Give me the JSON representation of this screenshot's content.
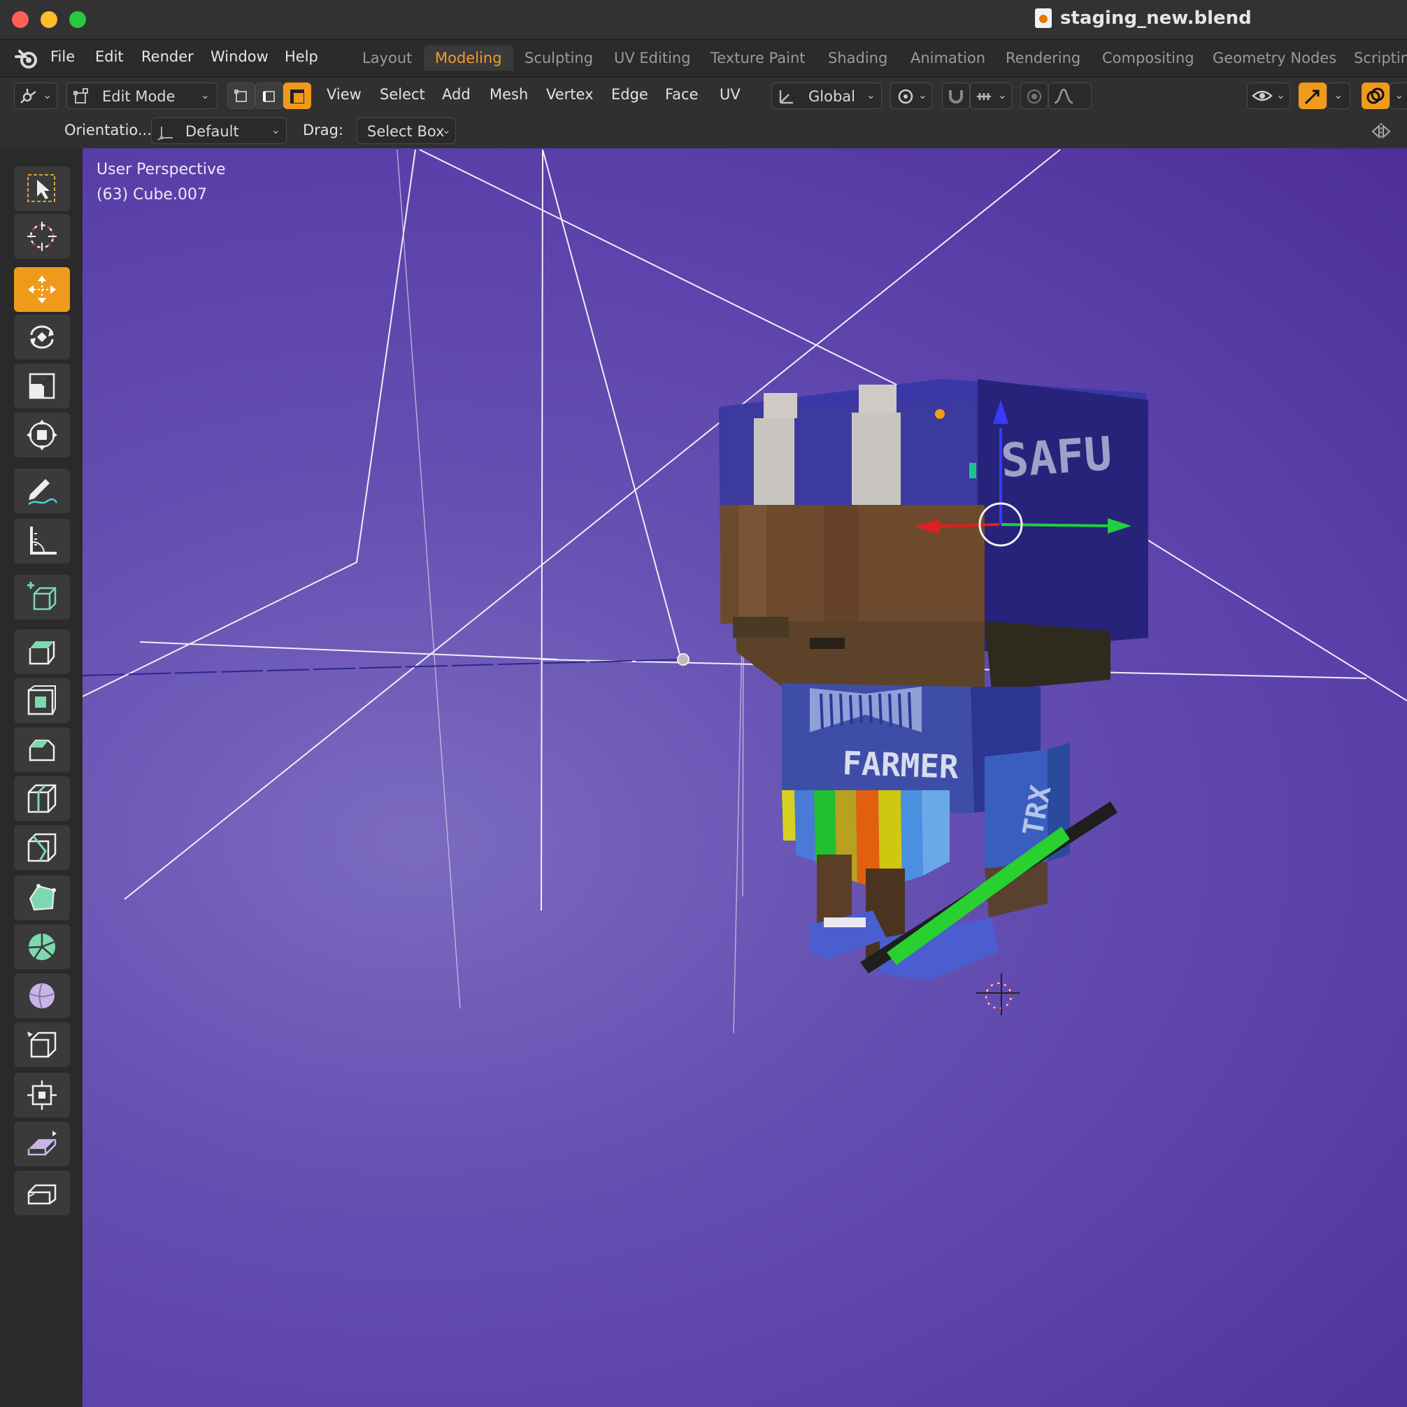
{
  "window": {
    "title": "staging_new.blend",
    "traffic_lights": {
      "close": "#ff5f57",
      "minimize": "#febc2e",
      "maximize": "#28c840"
    }
  },
  "menubar": {
    "items": [
      "File",
      "Edit",
      "Render",
      "Window",
      "Help"
    ],
    "workspaces": [
      "Layout",
      "Modeling",
      "Sculpting",
      "UV Editing",
      "Texture Paint",
      "Shading",
      "Animation",
      "Rendering",
      "Compositing",
      "Geometry Nodes",
      "Scriptin"
    ],
    "active_workspace": "Modeling"
  },
  "header": {
    "mode": "Edit Mode",
    "menus": [
      "View",
      "Select",
      "Add",
      "Mesh",
      "Vertex",
      "Edge",
      "Face",
      "UV"
    ],
    "transform_orientation": "Global",
    "accent": "#f09a1c"
  },
  "tool_settings": {
    "orientation_label": "Orientatio...",
    "orientation_value": "Default",
    "drag_label": "Drag:",
    "drag_value": "Select Box"
  },
  "viewport": {
    "view_name": "User Perspective",
    "object_info": "(63) Cube.007",
    "shirt_text": "FARMER",
    "hat_text": "SAFU",
    "arm_text": "TRX"
  },
  "toolbar": {
    "tools": [
      "select-box",
      "cursor",
      "move",
      "rotate",
      "scale",
      "transform",
      "annotate",
      "measure",
      "add-cube",
      "extrude",
      "inset",
      "bevel",
      "loop-cut",
      "knife",
      "poly-build",
      "spin",
      "smooth",
      "edge-slide",
      "shrink-fatten",
      "shear",
      "rip"
    ],
    "active_tool": "move"
  }
}
